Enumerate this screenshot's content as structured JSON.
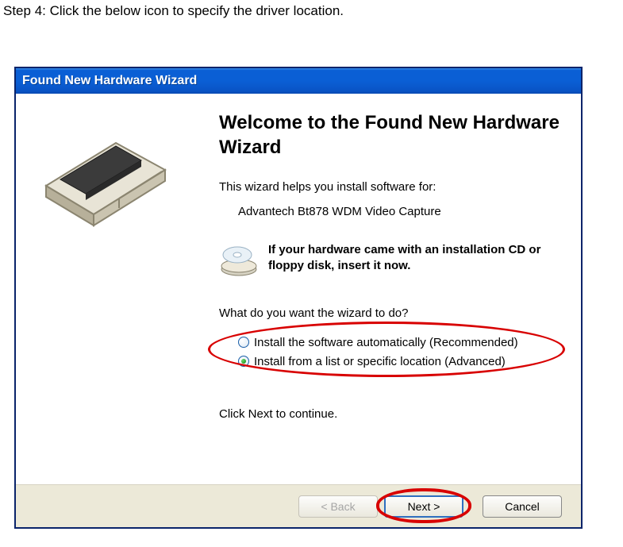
{
  "instruction": "Step 4: Click the below icon to specify the driver location.",
  "window": {
    "title": "Found New Hardware Wizard"
  },
  "wizard": {
    "heading": "Welcome to the Found New Hardware Wizard",
    "helps_line": "This wizard helps you install software for:",
    "device_name": "Advantech Bt878 WDM Video Capture",
    "cd_text": "If your hardware came with an installation CD or floppy disk, insert it now.",
    "question": "What do you want the wizard to do?",
    "radio": {
      "auto": "Install the software automatically (Recommended)",
      "list": "Install from a list or specific location (Advanced)"
    },
    "click_next": "Click Next to continue."
  },
  "buttons": {
    "back": "< Back",
    "next": "Next >",
    "cancel": "Cancel"
  }
}
